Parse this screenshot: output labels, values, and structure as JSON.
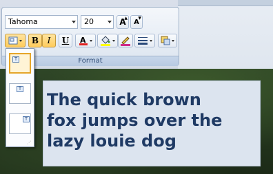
{
  "ribbon": {
    "font_name": "Tahoma",
    "font_size": "20",
    "grow_font_label": "A",
    "shrink_font_label": "A",
    "bold_label": "B",
    "italic_label": "I",
    "underline_label": "U",
    "font_color_label": "A",
    "group_label": "Format"
  },
  "gallery": {
    "item_glyph": "T"
  },
  "textbox": {
    "text": "The quick brown\nfox jumps over the\nlazy louie dog"
  },
  "colors": {
    "accent_active": "#ffcc5c",
    "text_color": "#1f3a64",
    "font_color_bar": "#e02020",
    "highlight_bar": "#ffff00"
  }
}
